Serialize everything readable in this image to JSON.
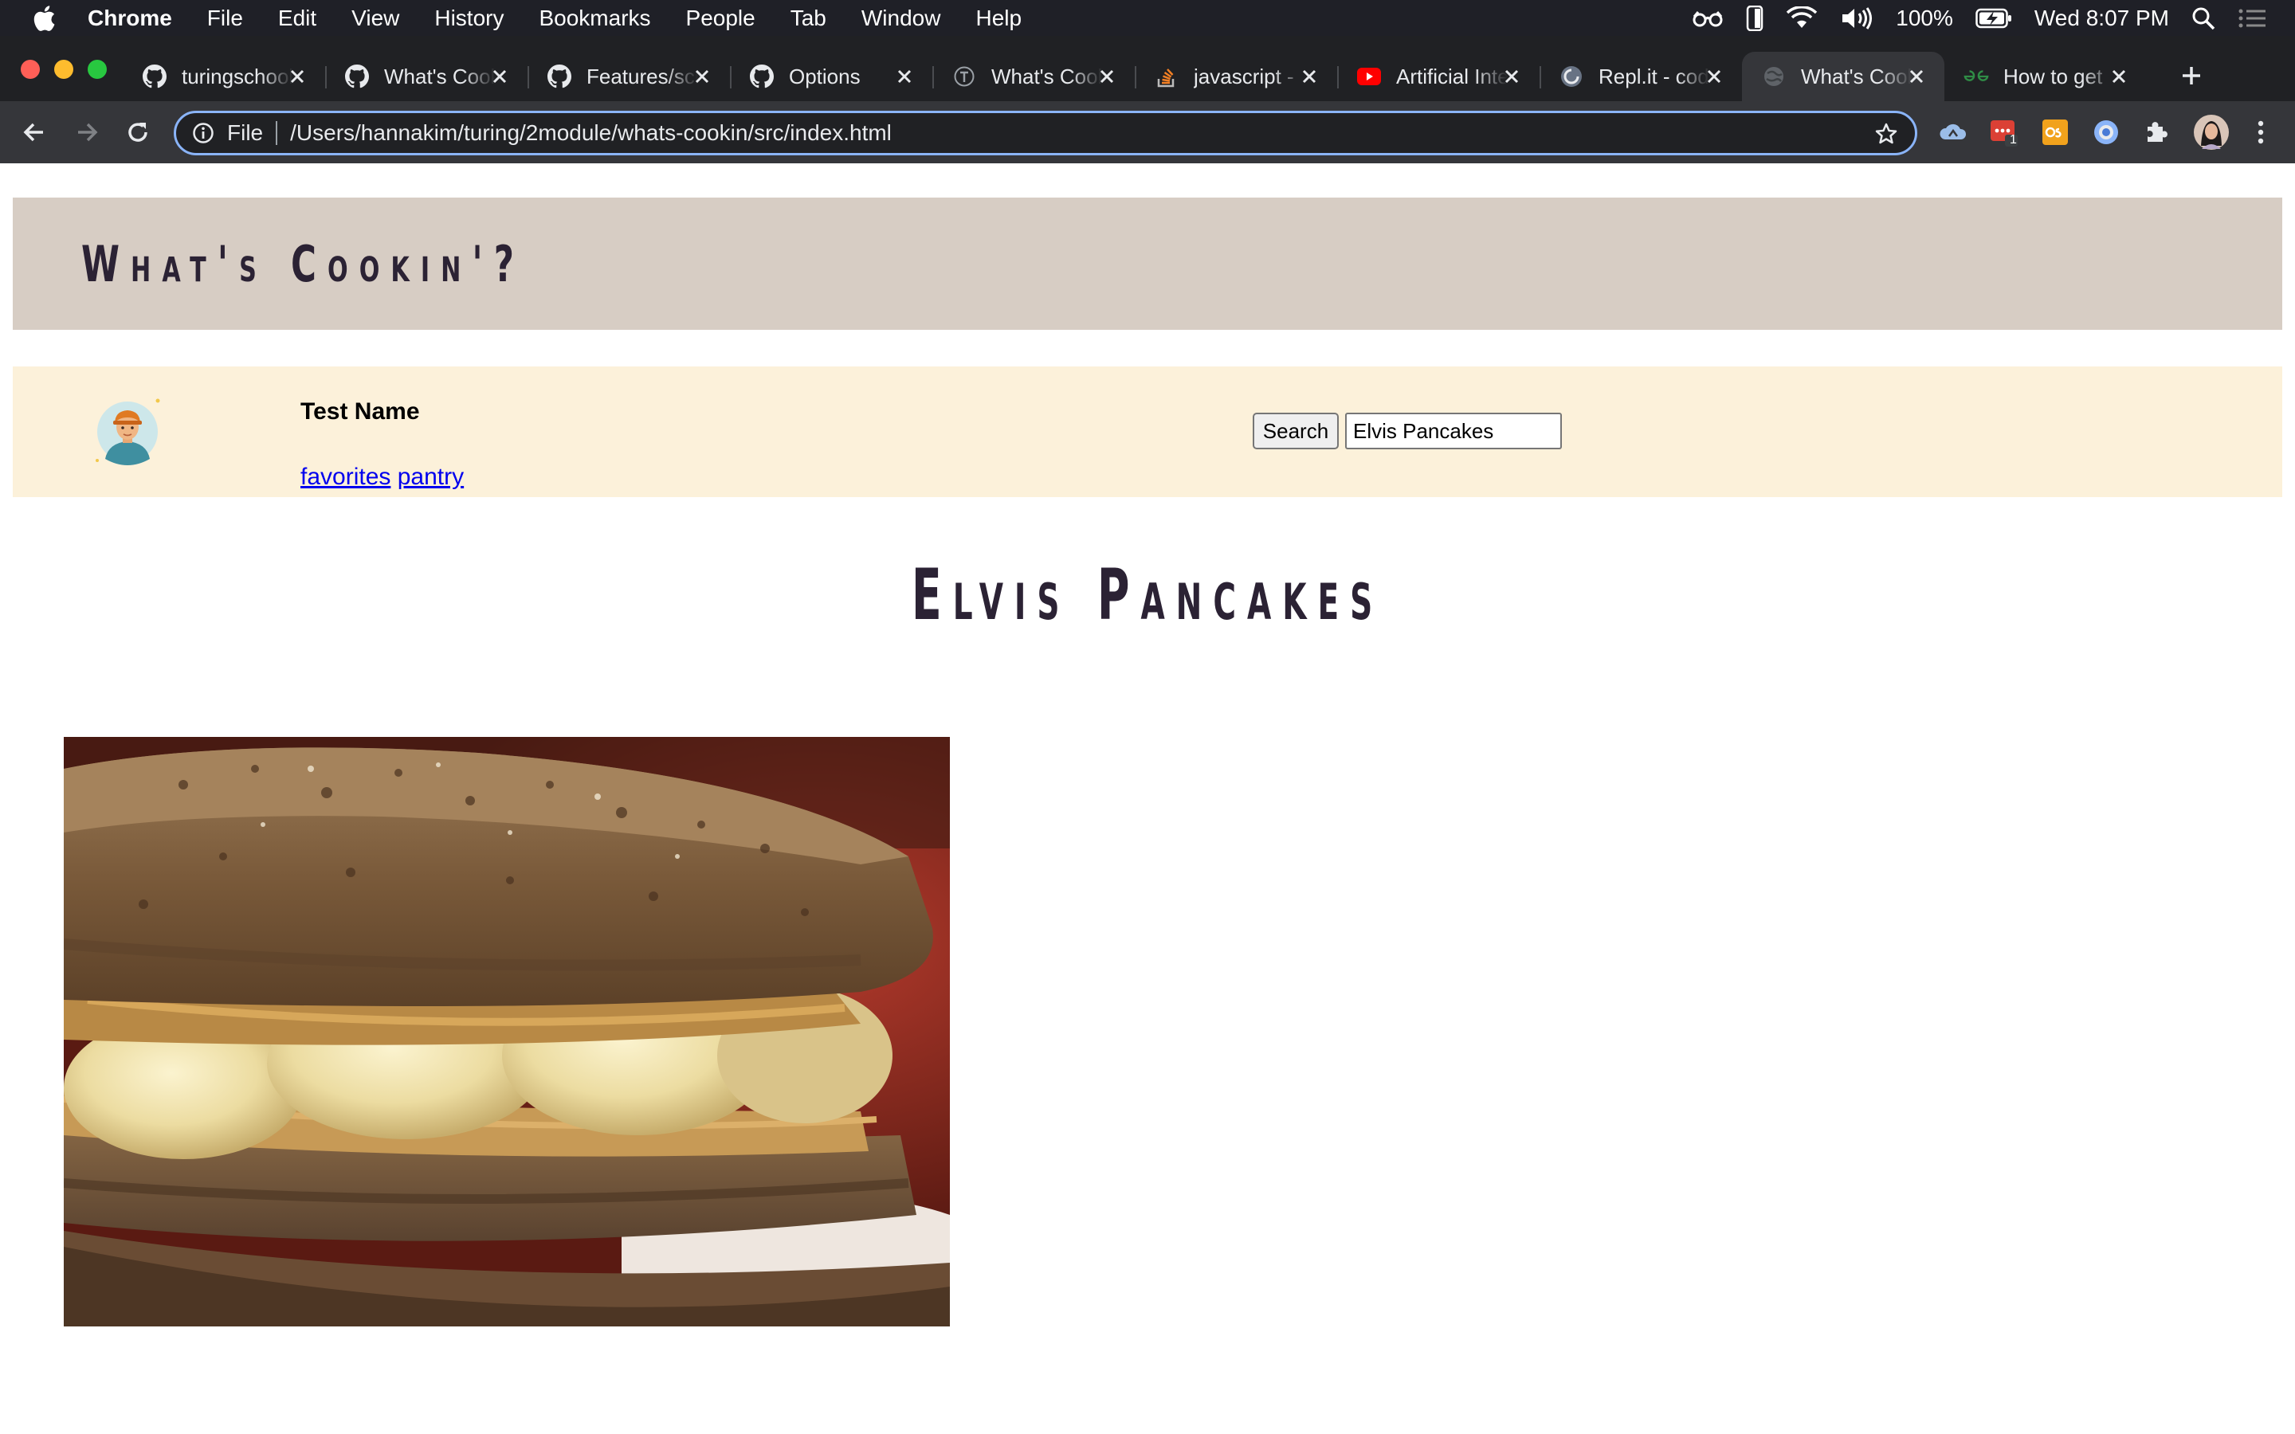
{
  "menubar": {
    "app_name": "Chrome",
    "items": [
      "File",
      "Edit",
      "View",
      "History",
      "Bookmarks",
      "People",
      "Tab",
      "Window",
      "Help"
    ],
    "battery": "100%",
    "clock": "Wed 8:07 PM",
    "icons": [
      "apple-icon",
      "reader-glasses-icon",
      "ios-device-icon",
      "wifi-icon",
      "volume-icon",
      "battery-charging-icon",
      "spotlight-search-icon",
      "notification-center-icon"
    ]
  },
  "browser": {
    "tabs": [
      {
        "title": "turingschool",
        "icon": "github-icon"
      },
      {
        "title": "What's Cookin",
        "icon": "github-icon"
      },
      {
        "title": "Features/scripts",
        "icon": "github-icon"
      },
      {
        "title": "Options",
        "icon": "github-icon"
      },
      {
        "title": "What's Cookin",
        "icon": "turing-icon"
      },
      {
        "title": "javascript - ",
        "icon": "stackoverflow-icon"
      },
      {
        "title": "Artificial Intelligence",
        "icon": "youtube-icon"
      },
      {
        "title": "Repl.it - code",
        "icon": "replit-icon"
      },
      {
        "title": "What's Cookin",
        "icon": "globe-icon",
        "active": true
      },
      {
        "title": "How to get",
        "icon": "geeksforgeeks-icon"
      }
    ],
    "address": {
      "scheme_label": "File",
      "url": "/Users/hannakim/turing/2module/whats-cookin/src/index.html"
    },
    "extensions": [
      "cloud-extension-icon",
      "todoist-extension-icon",
      "css-extension-icon",
      "circle-extension-icon",
      "puzzle-extensions-icon",
      "profile-avatar-icon",
      "more-menu-icon"
    ],
    "extension_badge": "1"
  },
  "site": {
    "title": "What's Cookin'?",
    "user": {
      "name": "Test Name",
      "links": [
        "favorites",
        "pantry"
      ]
    },
    "search": {
      "button_label": "Search",
      "value": "Elvis Pancakes"
    },
    "recipe": {
      "title": "Elvis Pancakes"
    }
  },
  "colors": {
    "header_bg": "#d7cdc4",
    "userbar_bg": "#fcf1da",
    "title_text": "#2b2234",
    "link": "#0000ee",
    "omnibox_focus": "#8ab4f8"
  }
}
